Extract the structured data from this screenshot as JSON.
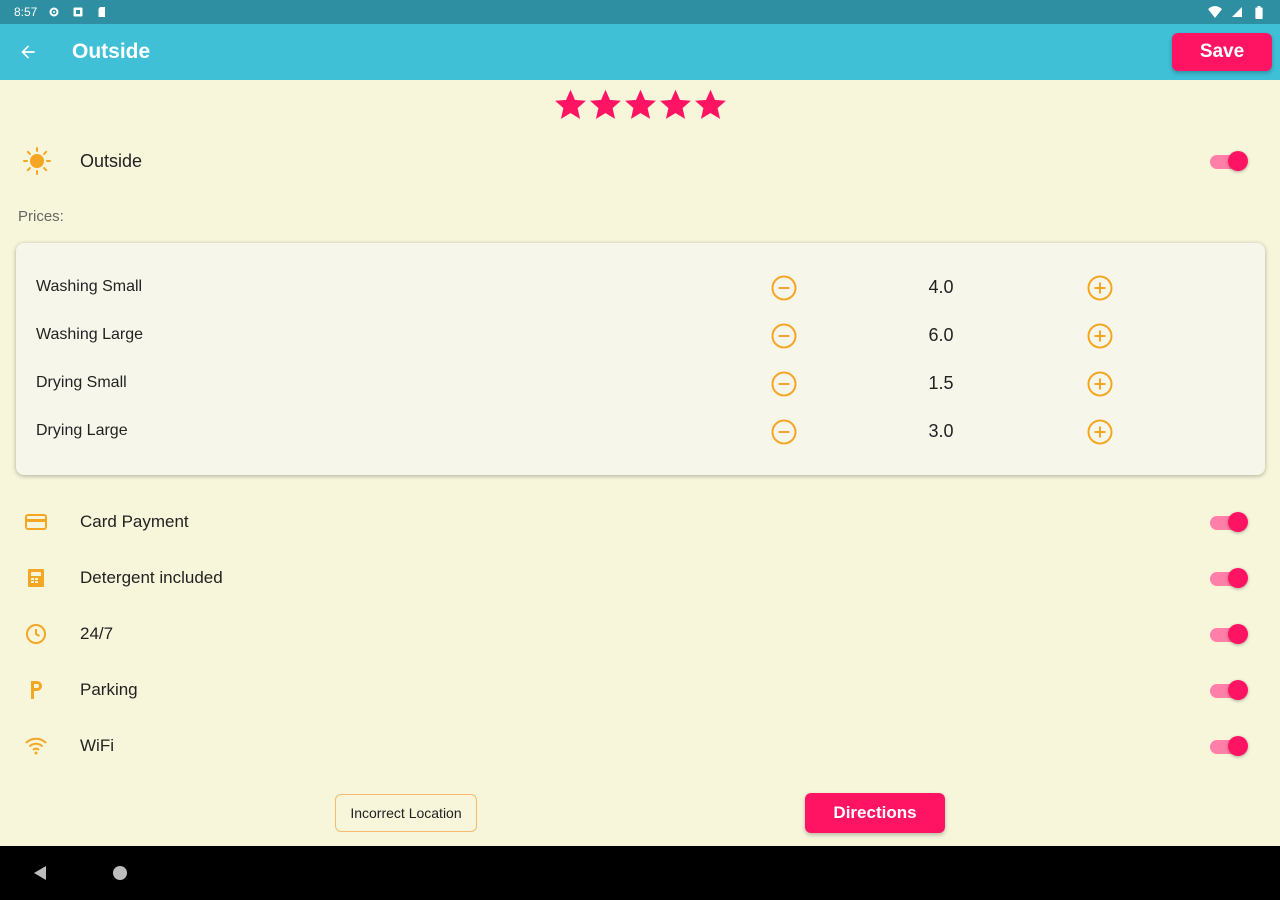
{
  "status_bar": {
    "time": "8:57"
  },
  "app_bar": {
    "title": "Outside",
    "save_label": "Save"
  },
  "rating": {
    "value": 5,
    "max": 5
  },
  "main_toggle": {
    "label": "Outside",
    "on": true
  },
  "prices": {
    "label": "Prices:",
    "items": [
      {
        "name": "Washing Small",
        "value": "4.0"
      },
      {
        "name": "Washing Large",
        "value": "6.0"
      },
      {
        "name": "Drying Small",
        "value": "1.5"
      },
      {
        "name": "Drying Large",
        "value": "3.0"
      }
    ]
  },
  "features": [
    {
      "label": "Card Payment",
      "icon": "credit-card-icon",
      "on": true
    },
    {
      "label": "Detergent included",
      "icon": "detergent-icon",
      "on": true
    },
    {
      "label": "24/7",
      "icon": "clock-icon",
      "on": true
    },
    {
      "label": "Parking",
      "icon": "parking-icon",
      "on": true
    },
    {
      "label": "WiFi",
      "icon": "wifi-icon",
      "on": true
    }
  ],
  "buttons": {
    "incorrect_location": "Incorrect Location",
    "directions": "Directions"
  },
  "colors": {
    "accent": "#FF1464",
    "app_bar": "#3FC0D6",
    "status_bar": "#2E8FA3",
    "icon_orange": "#F5A623",
    "background": "#F7F6DA"
  }
}
